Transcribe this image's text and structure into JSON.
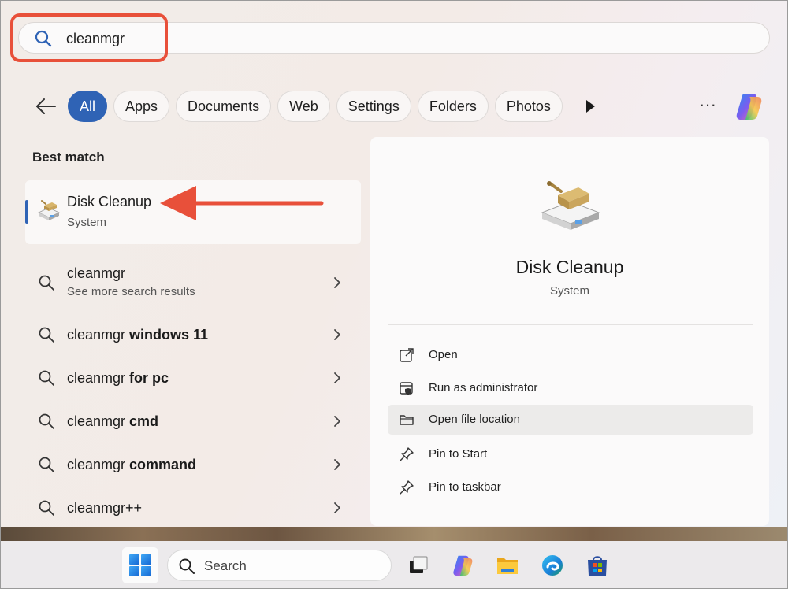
{
  "search": {
    "query": "cleanmgr"
  },
  "filters": {
    "chips": [
      {
        "label": "All",
        "active": true
      },
      {
        "label": "Apps",
        "active": false
      },
      {
        "label": "Documents",
        "active": false
      },
      {
        "label": "Web",
        "active": false
      },
      {
        "label": "Settings",
        "active": false
      },
      {
        "label": "Folders",
        "active": false
      },
      {
        "label": "Photos",
        "active": false
      }
    ],
    "more_label": "···"
  },
  "results": {
    "best_match_heading": "Best match",
    "best_match": {
      "title": "Disk Cleanup",
      "subtitle": "System",
      "icon": "disk-cleanup-icon"
    },
    "web_items": [
      {
        "prefix": "cleanmgr",
        "bold": "",
        "subtitle": "See more search results"
      },
      {
        "prefix": "cleanmgr ",
        "bold": "windows 11",
        "subtitle": ""
      },
      {
        "prefix": "cleanmgr ",
        "bold": "for pc",
        "subtitle": ""
      },
      {
        "prefix": "cleanmgr ",
        "bold": "cmd",
        "subtitle": ""
      },
      {
        "prefix": "cleanmgr ",
        "bold": "command",
        "subtitle": ""
      },
      {
        "prefix": "cleanmgr++",
        "bold": "",
        "subtitle": ""
      }
    ]
  },
  "details": {
    "title": "Disk Cleanup",
    "subtitle": "System",
    "actions": [
      {
        "label": "Open",
        "icon": "open-external-icon"
      },
      {
        "label": "Run as administrator",
        "icon": "shield-admin-icon"
      },
      {
        "label": "Open file location",
        "icon": "folder-icon",
        "highlighted": true
      },
      {
        "label": "Pin to Start",
        "icon": "pin-icon"
      },
      {
        "label": "Pin to taskbar",
        "icon": "pin-icon"
      }
    ]
  },
  "taskbar": {
    "search_label": "Search",
    "apps": [
      "start-icon",
      "task-view-icon",
      "copilot-icon",
      "file-explorer-icon",
      "edge-icon",
      "store-icon"
    ]
  },
  "colors": {
    "accent": "#2f63b5",
    "callout": "#e8503a"
  }
}
